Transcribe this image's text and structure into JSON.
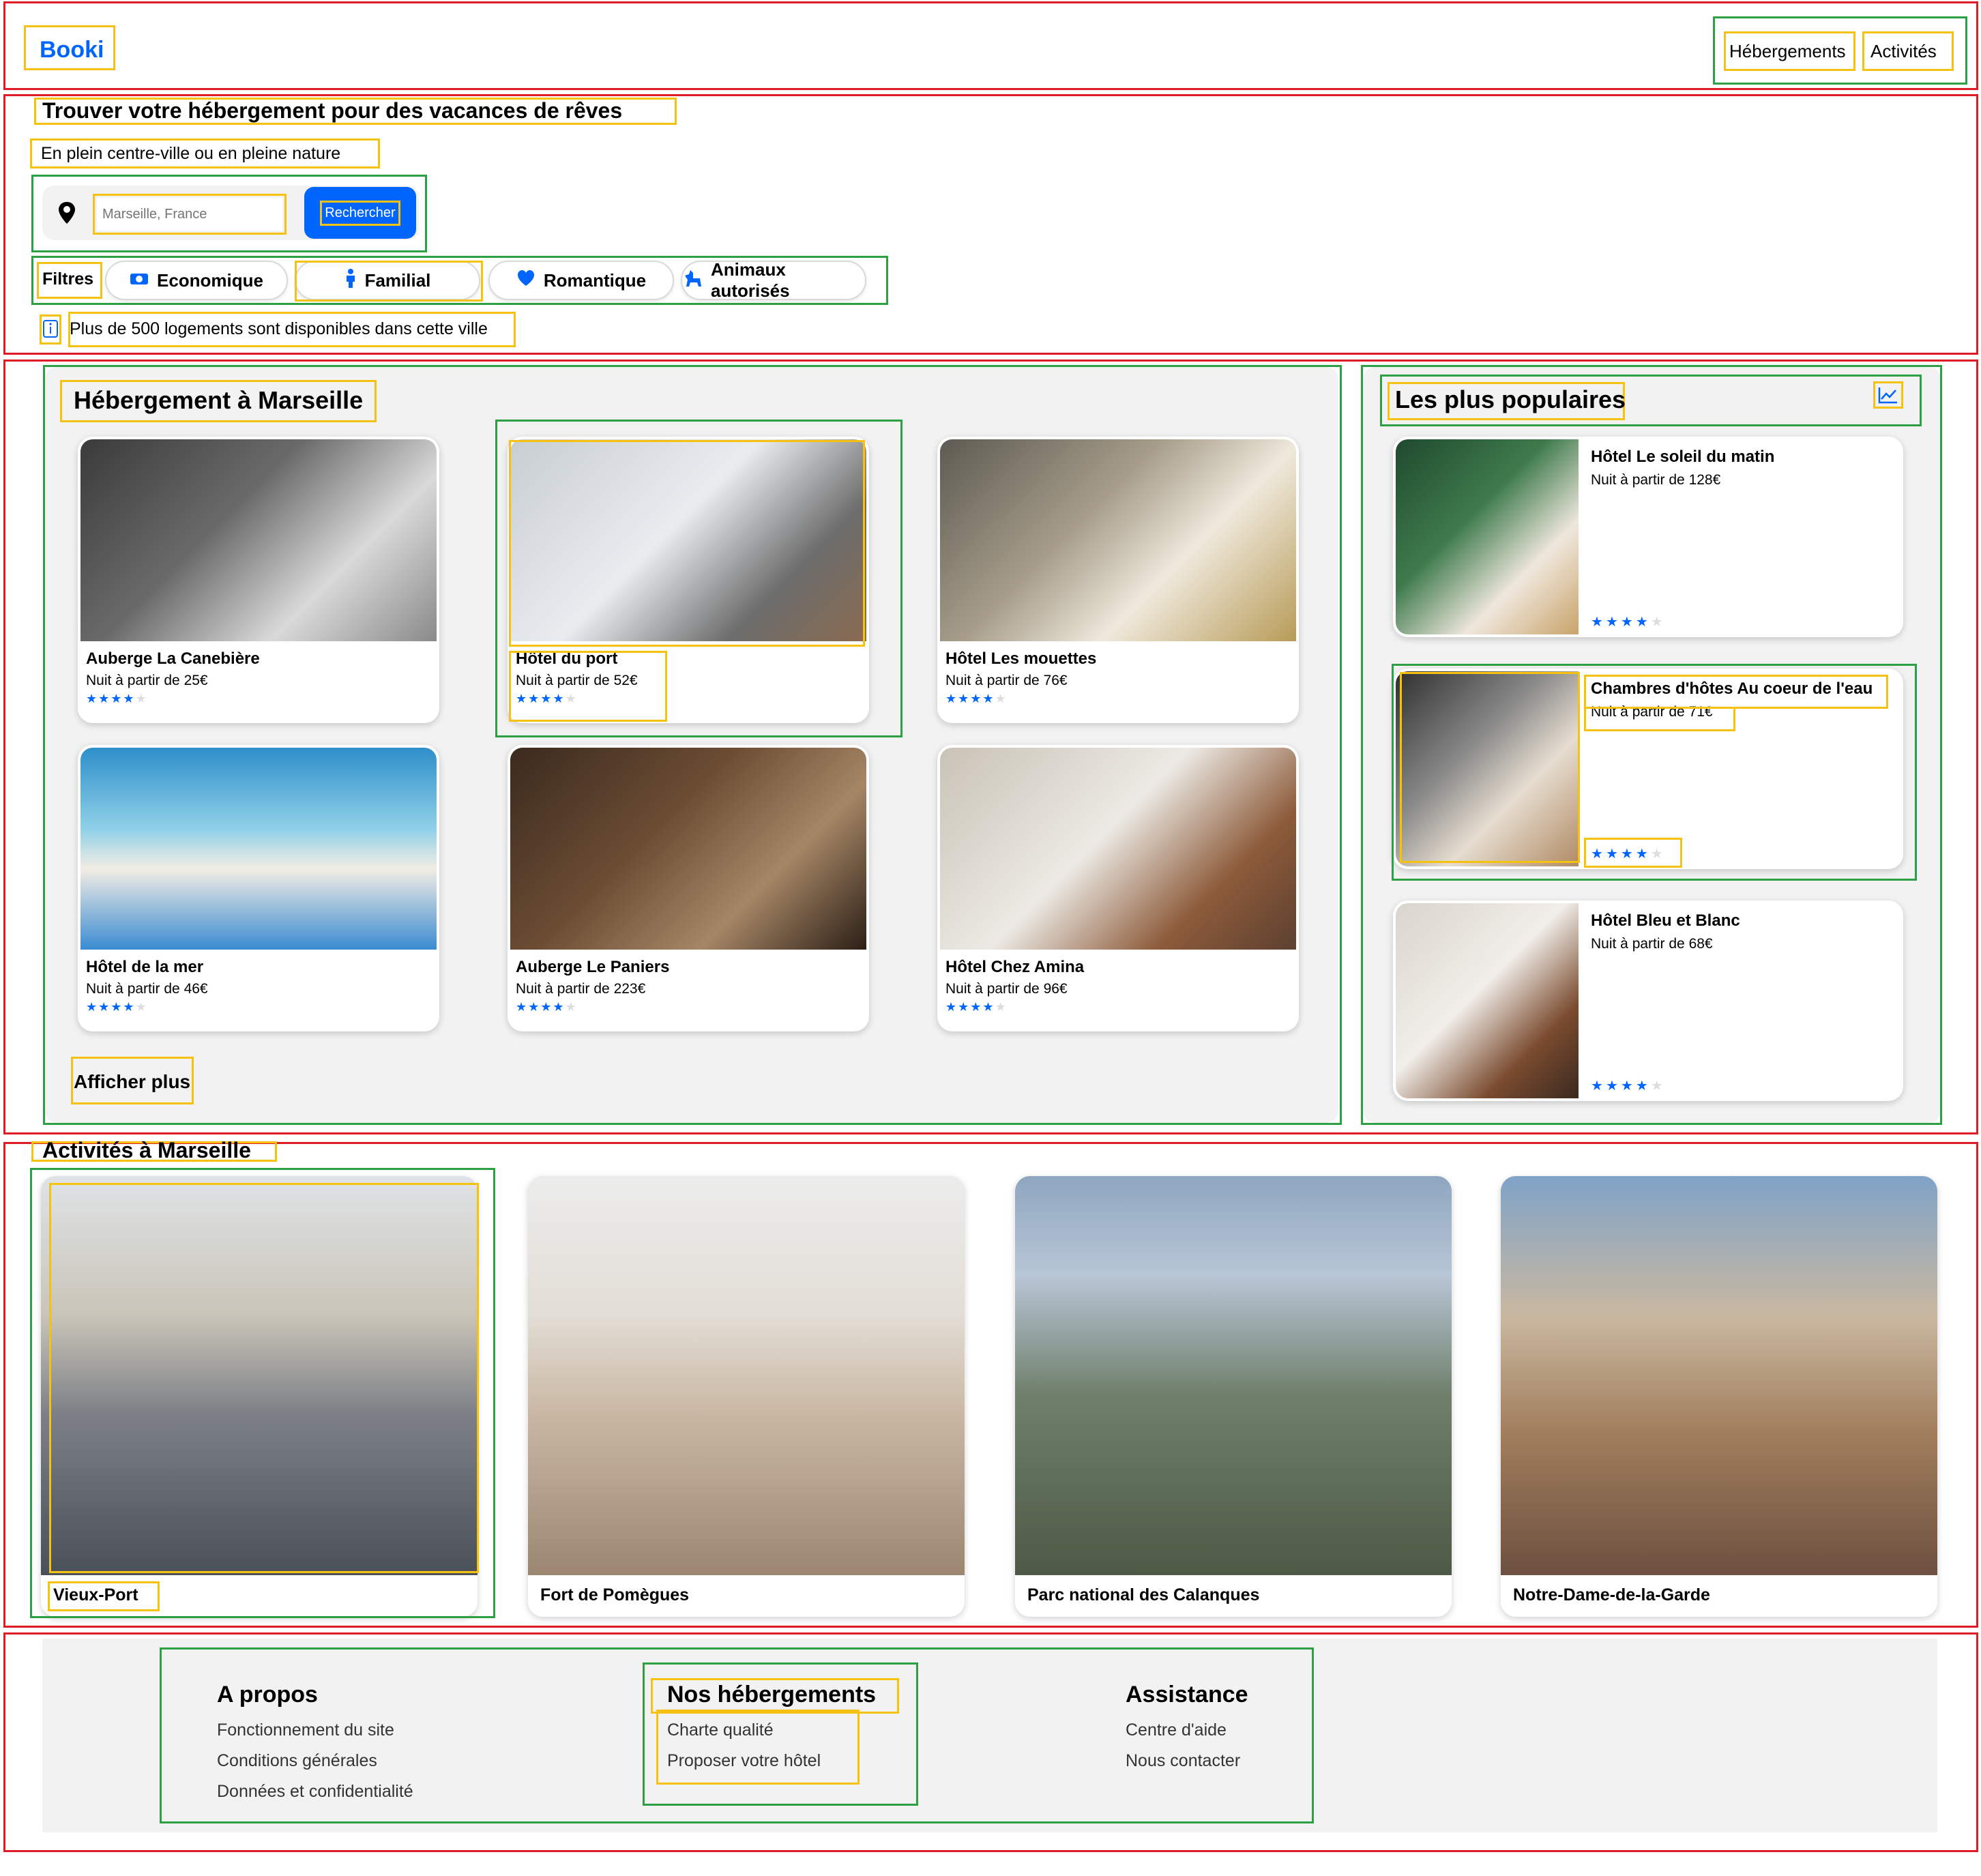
{
  "header": {
    "logo": "Booki",
    "nav": [
      "Hébergements",
      "Activités"
    ]
  },
  "hero": {
    "title": "Trouver votre hébergement pour des vacances de rêves",
    "subtitle": "En plein centre-ville ou en pleine nature",
    "search_placeholder": "Marseille, France",
    "search_button": "Rechercher",
    "filters_label": "Filtres",
    "filters": [
      "Economique",
      "Familial",
      "Romantique",
      "Animaux autorisés"
    ],
    "info_text": "Plus de 500 logements sont disponibles dans cette ville"
  },
  "lodging": {
    "title": "Hébergement à Marseille",
    "show_more": "Afficher plus",
    "cards": [
      {
        "name": "Auberge La Canebière",
        "price": "Nuit à partir de 25€",
        "rating": 4
      },
      {
        "name": "Hôtel du port",
        "price": "Nuit à partir de 52€",
        "rating": 4
      },
      {
        "name": "Hôtel Les mouettes",
        "price": "Nuit à partir de 76€",
        "rating": 4
      },
      {
        "name": "Hôtel de la mer",
        "price": "Nuit à partir de 46€",
        "rating": 4
      },
      {
        "name": "Auberge Le Paniers",
        "price": "Nuit à partir de 223€",
        "rating": 4
      },
      {
        "name": "Hôtel Chez Amina",
        "price": "Nuit à partir de 96€",
        "rating": 4
      }
    ]
  },
  "popular": {
    "title": "Les plus populaires",
    "cards": [
      {
        "name": "Hôtel Le soleil du matin",
        "price": "Nuit à partir de 128€",
        "rating": 4
      },
      {
        "name": "Chambres d'hôtes Au coeur de l'eau",
        "price": "Nuit à partir de 71€",
        "rating": 4
      },
      {
        "name": "Hôtel Bleu et Blanc",
        "price": "Nuit à partir de 68€",
        "rating": 4
      }
    ]
  },
  "activities": {
    "title": "Activités à Marseille",
    "cards": [
      "Vieux-Port",
      "Fort de Pomègues",
      "Parc national des Calanques",
      "Notre-Dame-de-la-Garde"
    ]
  },
  "footer": {
    "columns": [
      {
        "title": "A propos",
        "links": [
          "Fonctionnement du site",
          "Conditions générales",
          "Données et confidentialité"
        ]
      },
      {
        "title": "Nos hébergements",
        "links": [
          "Charte qualité",
          "Proposer votre hôtel"
        ]
      },
      {
        "title": "Assistance",
        "links": [
          "Centre d'aide",
          "Nous contacter"
        ]
      }
    ]
  },
  "colors": {
    "brand": "#0065fc",
    "annotation_red": "#e01b24",
    "annotation_green": "#2ea043",
    "annotation_yellow": "#f5c211",
    "panel_bg": "#f2f2f2"
  },
  "icons": [
    "map-pin-icon",
    "money-icon",
    "person-icon",
    "heart-icon",
    "dog-icon",
    "info-icon",
    "trend-chart-icon",
    "star-icon"
  ]
}
